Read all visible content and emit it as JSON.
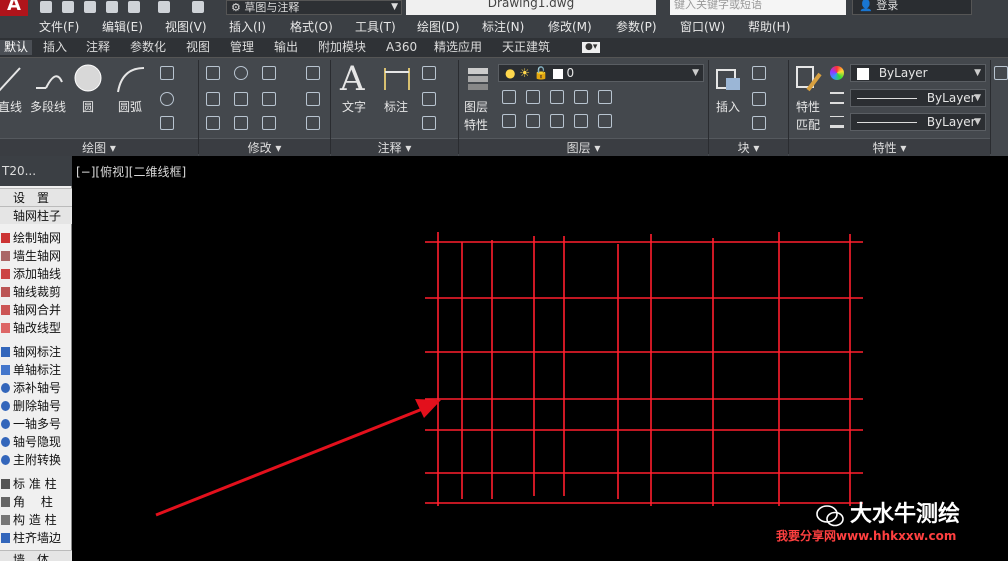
{
  "titlebar": {
    "app_logo": "A",
    "workspace": "草图与注释",
    "document_title": "Drawing1.dwg",
    "search_placeholder": "键入关键字或短语",
    "login": "登录"
  },
  "menu": {
    "items": [
      "文件(F)",
      "编辑(E)",
      "视图(V)",
      "插入(I)",
      "格式(O)",
      "工具(T)",
      "绘图(D)",
      "标注(N)",
      "修改(M)",
      "参数(P)",
      "窗口(W)",
      "帮助(H)"
    ]
  },
  "ribbon_tabs": {
    "items": [
      "默认",
      "插入",
      "注释",
      "参数化",
      "视图",
      "管理",
      "输出",
      "附加模块",
      "A360",
      "精选应用",
      "天正建筑"
    ]
  },
  "ribbon": {
    "draw": {
      "line": "直线",
      "polyline": "多段线",
      "circle": "圆",
      "arc": "圆弧",
      "panel": "绘图 ▾"
    },
    "modify": {
      "panel": "修改 ▾"
    },
    "annotation": {
      "text": "文字",
      "dimension": "标注",
      "panel": "注释 ▾"
    },
    "layers": {
      "layer_props_1": "图层",
      "layer_props_2": "特性",
      "current_layer": "0",
      "panel": "图层 ▾"
    },
    "block": {
      "insert": "插入",
      "panel": "块 ▾"
    },
    "properties": {
      "match_1": "特性",
      "match_2": "匹配",
      "color": "ByLayer",
      "linetype": "ByLayer",
      "lineweight": "ByLayer",
      "panel": "特性 ▾"
    }
  },
  "palette": {
    "header": "T20...",
    "items": [
      "设　置",
      "轴网柱子",
      "绘制轴网",
      "墙生轴网",
      "添加轴线",
      "轴线裁剪",
      "轴网合并",
      "轴改线型",
      "轴网标注",
      "单轴标注",
      "添补轴号",
      "删除轴号",
      "一轴多号",
      "轴号隐现",
      "主附转换",
      "标 准 柱",
      "角　 柱",
      "构 造 柱",
      "柱齐墙边",
      "墙　体"
    ]
  },
  "canvas": {
    "view_label": "[−][俯视][二维线框]"
  },
  "watermark": {
    "title": "大水牛测绘",
    "url": "我要分享网www.hhkxxw.com"
  },
  "colors": {
    "grid_line": "#ff1f2e",
    "arrow": "#e3101c"
  }
}
